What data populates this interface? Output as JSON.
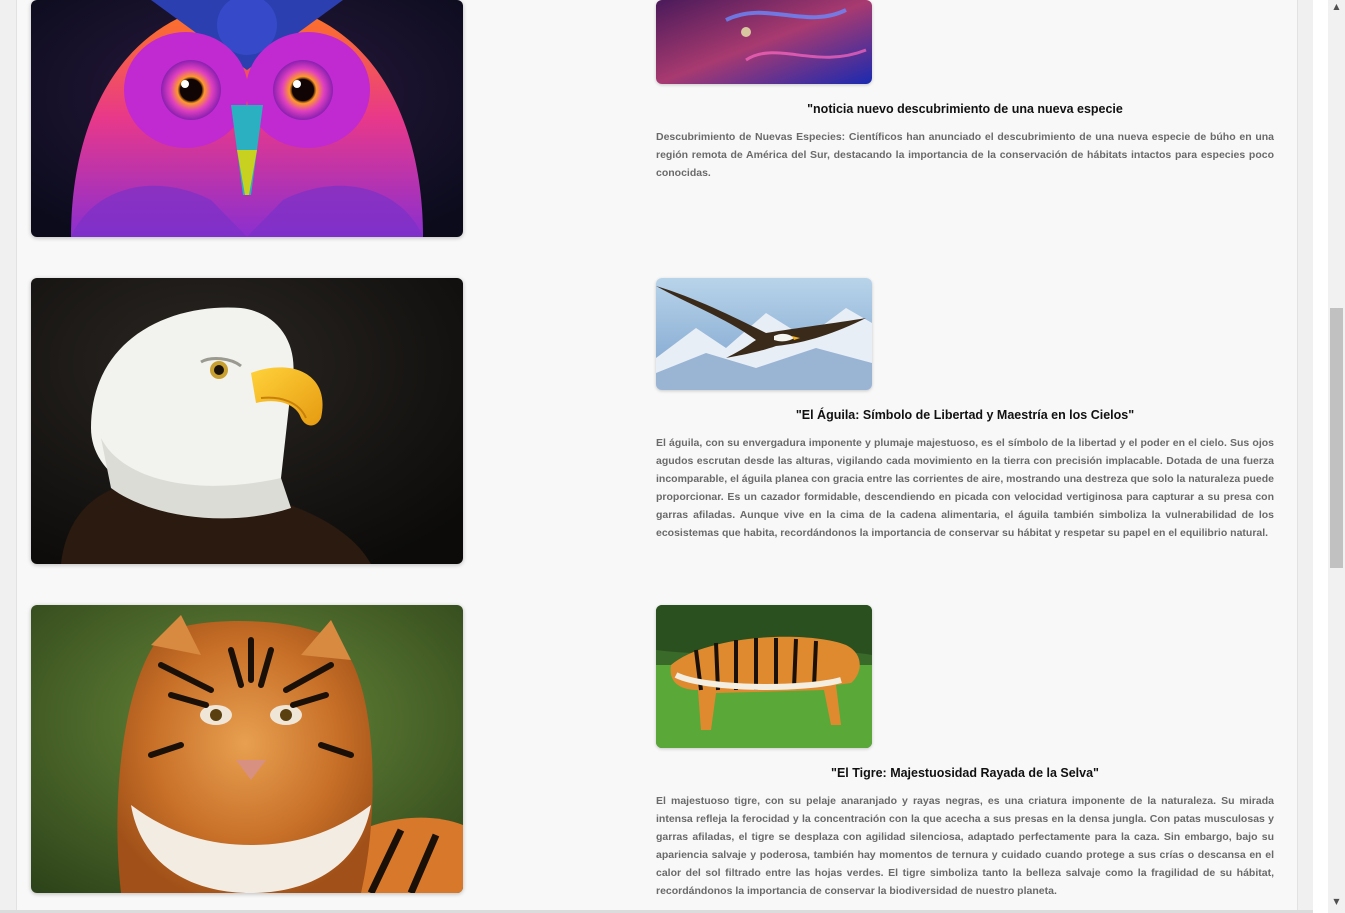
{
  "articles": [
    {
      "title": "\"noticia nuevo descubrimiento de una nueva especie",
      "description": "Descubrimiento de Nuevas Especies: Científicos han anunciado el descubrimiento de una nueva especie de búho en una región remota de América del Sur, destacando la importancia de la conservación de hábitats intactos para especies poco conocidas."
    },
    {
      "title": "\"El Águila: Símbolo de Libertad y Maestría en los Cielos\"",
      "description": "El águila, con su envergadura imponente y plumaje majestuoso, es el símbolo de la libertad y el poder en el cielo. Sus ojos agudos escrutan desde las alturas, vigilando cada movimiento en la tierra con precisión implacable. Dotada de una fuerza incomparable, el águila planea con gracia entre las corrientes de aire, mostrando una destreza que solo la naturaleza puede proporcionar. Es un cazador formidable, descendiendo en picada con velocidad vertiginosa para capturar a su presa con garras afiladas. Aunque vive en la cima de la cadena alimentaria, el águila también simboliza la vulnerabilidad de los ecosistemas que habita, recordándonos la importancia de conservar su hábitat y respetar su papel en el equilibrio natural."
    },
    {
      "title": "\"El Tigre: Majestuosidad Rayada de la Selva\"",
      "description": "El majestuoso tigre, con su pelaje anaranjado y rayas negras, es una criatura imponente de la naturaleza. Su mirada intensa refleja la ferocidad y la concentración con la que acecha a sus presas en la densa jungla. Con patas musculosas y garras afiladas, el tigre se desplaza con agilidad silenciosa, adaptado perfectamente para la caza. Sin embargo, bajo su apariencia salvaje y poderosa, también hay momentos de ternura y cuidado cuando protege a sus crías o descansa en el calor del sol filtrado entre las hojas verdes. El tigre simboliza tanto la belleza salvaje como la fragilidad de su hábitat, recordándonos la importancia de conservar la biodiversidad de nuestro planeta."
    }
  ],
  "scrollbar": {
    "up_glyph": "▲",
    "down_glyph": "▼",
    "position_fraction": 0.34
  }
}
